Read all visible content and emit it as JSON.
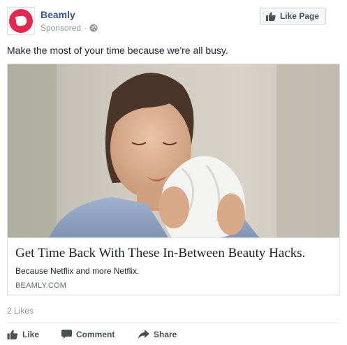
{
  "header": {
    "page_name": "Beamly",
    "sponsored_label": "Sponsored",
    "separator": "·",
    "like_page_label": "Like Page",
    "avatar_icon": "beamly-logo-icon",
    "privacy_icon": "globe-icon",
    "like_icon": "thumbs-up-icon"
  },
  "post": {
    "text": "Make the most of your time because we're all busy."
  },
  "card": {
    "title": "Get Time Back With These In-Between Beauty Hacks.",
    "description": "Because Netflix and more Netflix.",
    "domain": "BEAMLY.COM"
  },
  "stats": {
    "likes": "2 Likes"
  },
  "actions": {
    "like": "Like",
    "comment": "Comment",
    "share": "Share"
  },
  "colors": {
    "brand": "#e5284f",
    "link": "#365899",
    "muted": "#90949c",
    "action": "#4b4f56"
  }
}
